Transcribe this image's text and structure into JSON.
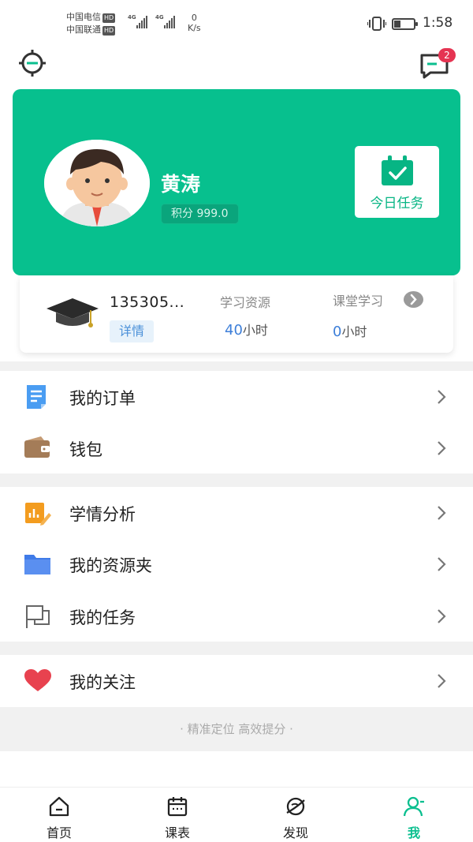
{
  "status_bar": {
    "carrier_1": "中国电信",
    "carrier_2": "中国联通",
    "hd": "HD",
    "network": "4G",
    "speed_value": "0",
    "speed_unit": "K/s",
    "time": "1:58",
    "battery_level_percent": 35
  },
  "header": {
    "settings_icon": "settings-icon",
    "messages_icon": "message-icon",
    "message_badge": "2"
  },
  "profile": {
    "name": "黄涛",
    "points": "积分 999.0",
    "today_task_label": "今日任务"
  },
  "account": {
    "number": "135305...",
    "detail_label": "详情",
    "study_resources_label": "学习资源",
    "study_resources_value": "40",
    "study_resources_unit": "小时",
    "classroom_label": "课堂学习",
    "classroom_value": "0",
    "classroom_unit": "小时"
  },
  "menu": {
    "orders": "我的订单",
    "wallet": "钱包",
    "analysis": "学情分析",
    "resource_folder": "我的资源夹",
    "tasks": "我的任务",
    "follows": "我的关注"
  },
  "slogan": "· 精准定位 高效提分 ·",
  "tabs": [
    {
      "label": "首页",
      "icon": "home-icon"
    },
    {
      "label": "课表",
      "icon": "calendar-icon"
    },
    {
      "label": "发现",
      "icon": "discover-icon"
    },
    {
      "label": "我",
      "icon": "profile-icon",
      "active": true
    }
  ],
  "colors": {
    "brand_green": "#07c08e",
    "badge_red": "#e53452",
    "accent_blue": "#3d7fd9"
  }
}
